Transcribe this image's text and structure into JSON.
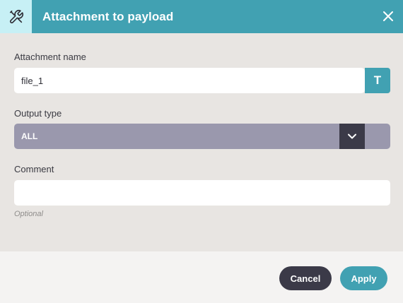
{
  "dialog": {
    "title": "Attachment to payload",
    "header_icon": "tools-icon",
    "close_icon": "close-icon"
  },
  "fields": {
    "attachment_name": {
      "label": "Attachment name",
      "value": "file_1",
      "type_button_label": "T"
    },
    "output_type": {
      "label": "Output type",
      "value": "ALL",
      "arrow_icon": "chevron-down-icon"
    },
    "comment": {
      "label": "Comment",
      "value": "",
      "hint": "Optional"
    }
  },
  "footer": {
    "cancel_label": "Cancel",
    "apply_label": "Apply"
  },
  "colors": {
    "accent": "#41a1b2",
    "header_icon_bg": "#c7f0f5",
    "select_bg": "#9a98ad",
    "dark": "#3b3a48",
    "body_bg": "#e8e5e2"
  }
}
